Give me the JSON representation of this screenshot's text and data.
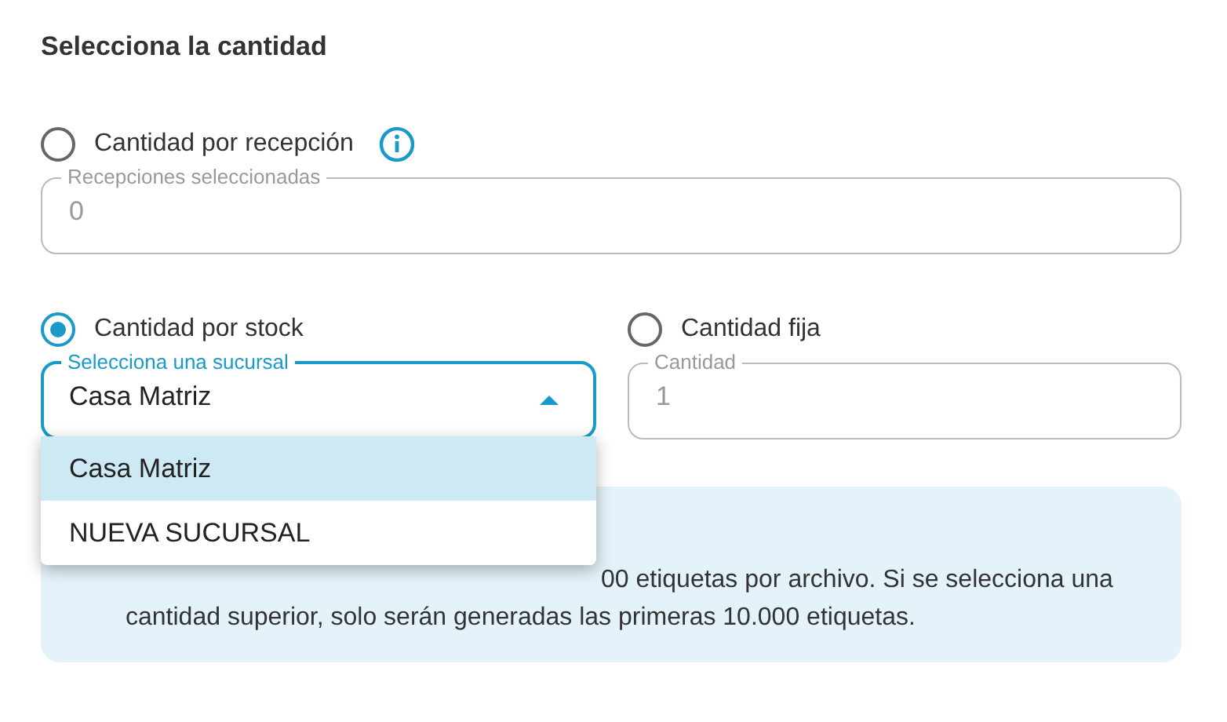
{
  "heading": "Selecciona la cantidad",
  "reception": {
    "option": {
      "label": "Cantidad por recepción",
      "selected": false
    },
    "field": {
      "label": "Recepciones seleccionadas",
      "value": "0",
      "disabled": true
    }
  },
  "stock": {
    "option": {
      "label": "Cantidad por stock",
      "selected": true
    },
    "select": {
      "label": "Selecciona una sucursal",
      "value": "Casa Matriz",
      "expanded": true,
      "options": [
        {
          "label": "Casa Matriz",
          "selected": true
        },
        {
          "label": "NUEVA SUCURSAL",
          "selected": false
        }
      ]
    }
  },
  "fixed": {
    "option": {
      "label": "Cantidad fija",
      "selected": false
    },
    "field": {
      "label": "Cantidad",
      "value": "1",
      "disabled": true
    }
  },
  "notice": {
    "lines": [
      "00 etiquetas por archivo. Si se selecciona una",
      "cantidad superior, solo serán generadas las primeras 10.000 etiquetas."
    ]
  }
}
